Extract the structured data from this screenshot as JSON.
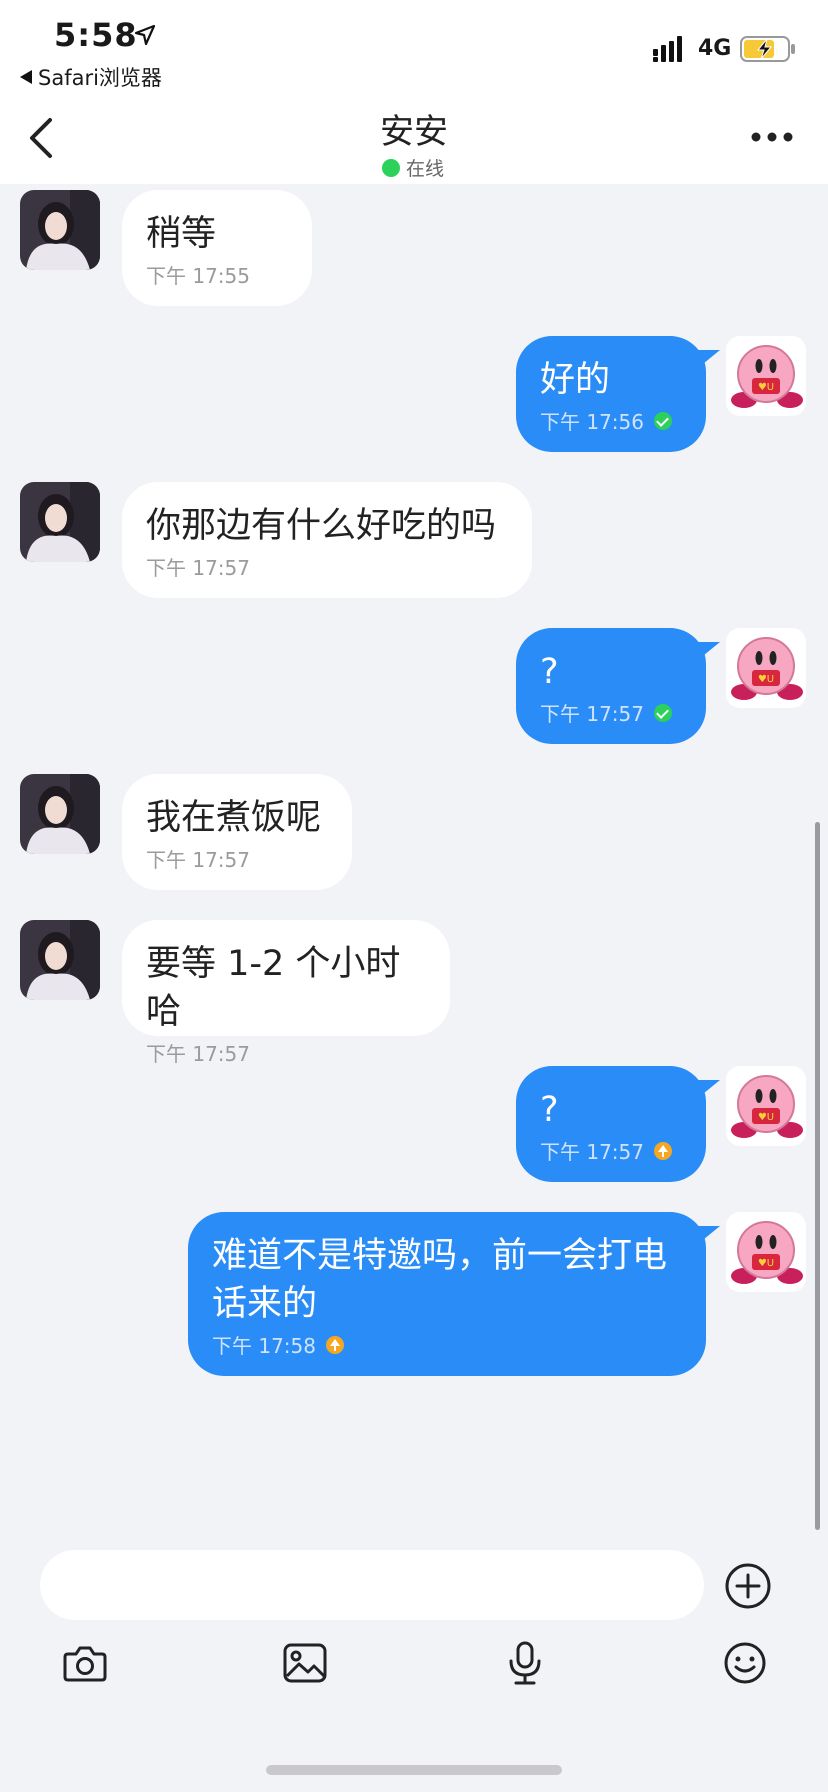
{
  "status_bar": {
    "time": "5:58",
    "back_app": "Safari浏览器",
    "network": "4G"
  },
  "header": {
    "title": "安安",
    "status": "在线"
  },
  "messages": [
    {
      "side": "in",
      "text": "稍等",
      "time": "下午 17:55"
    },
    {
      "side": "out",
      "text": "好的",
      "time": "下午 17:56",
      "state": "delivered"
    },
    {
      "side": "in",
      "text": "你那边有什么好吃的吗",
      "time": "下午 17:57"
    },
    {
      "side": "out",
      "text": "?",
      "time": "下午 17:57",
      "state": "delivered"
    },
    {
      "side": "in",
      "text": "我在煮饭呢",
      "time": "下午 17:57"
    },
    {
      "side": "in",
      "text": "要等 1-2 个小时哈",
      "time": "下午 17:57"
    },
    {
      "side": "out",
      "text": "?",
      "time": "下午 17:57",
      "state": "sending"
    },
    {
      "side": "out",
      "text": "难道不是特邀吗，前一会打电\n话来的",
      "time": "下午 17:58",
      "state": "sending"
    }
  ],
  "input": {
    "value": "",
    "placeholder": ""
  },
  "colors": {
    "outgoing_bubble": "#2a8cf7",
    "incoming_bubble": "#ffffff",
    "online": "#2bd15b",
    "pending": "#f5a623",
    "background": "#f2f3f7"
  },
  "icons": {
    "back": "chevron-left-icon",
    "more": "more-dots-icon",
    "plus": "plus-circle-icon",
    "camera": "camera-icon",
    "image": "image-icon",
    "mic": "microphone-icon",
    "emoji": "emoji-icon"
  }
}
